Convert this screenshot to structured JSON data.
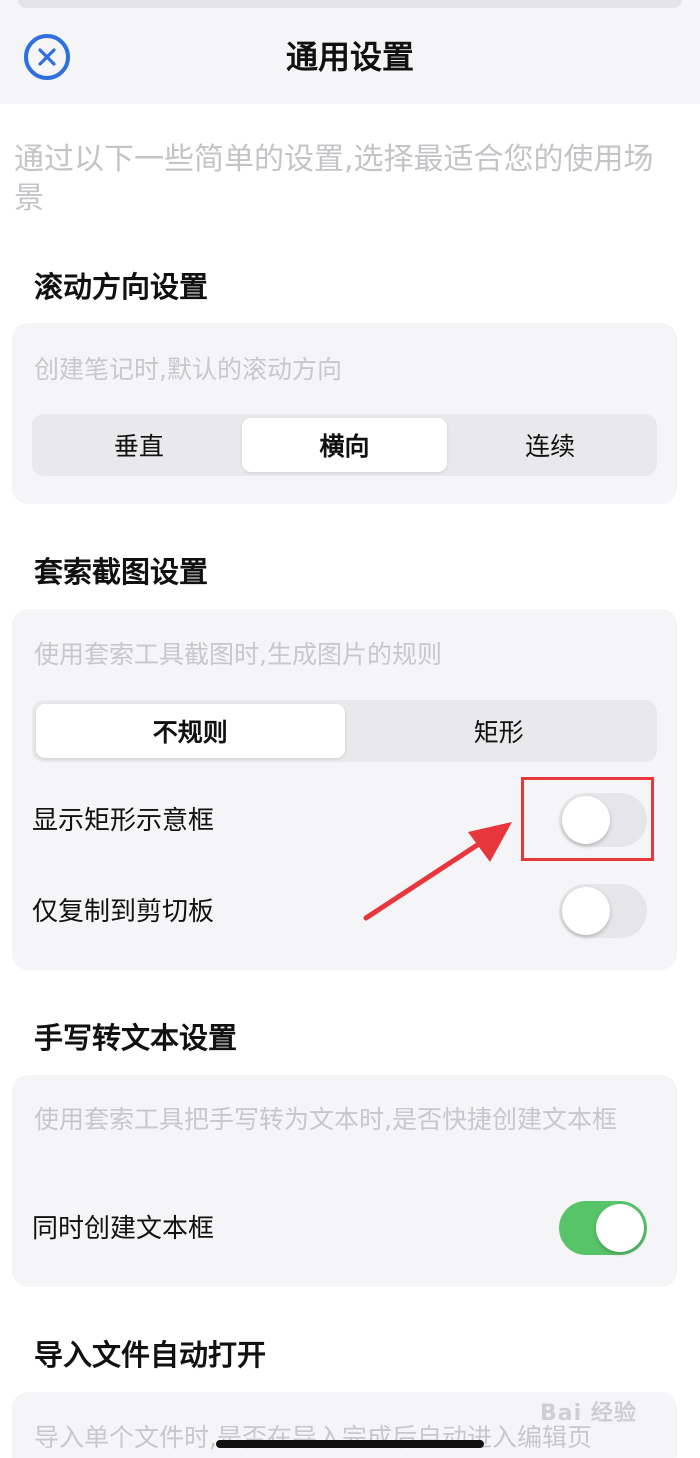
{
  "header": {
    "title": "通用设置",
    "close_icon": "close-circle-icon",
    "accent_color": "#2f6fe0"
  },
  "intro": "通过以下一些简单的设置,选择最适合您的使用场景",
  "sections": {
    "scroll": {
      "title": "滚动方向设置",
      "description": "创建笔记时,默认的滚动方向",
      "options": [
        "垂直",
        "横向",
        "连续"
      ],
      "selected": "横向"
    },
    "lasso": {
      "title": "套索截图设置",
      "description": "使用套索工具截图时,生成图片的规则",
      "options": [
        "不规则",
        "矩形"
      ],
      "selected": "不规则",
      "toggles": [
        {
          "label": "显示矩形示意框",
          "on": false
        },
        {
          "label": "仅复制到剪切板",
          "on": false
        }
      ]
    },
    "handwriting": {
      "title": "手写转文本设置",
      "description": "使用套索工具把手写转为文本时,是否快捷创建文本框",
      "toggles": [
        {
          "label": "同时创建文本框",
          "on": true
        }
      ]
    },
    "import": {
      "title": "导入文件自动打开",
      "description": "导入单个文件时,是否在导入完成后自动进入编辑页"
    }
  },
  "annotation": {
    "highlight_color": "#e8363d"
  },
  "watermark": {
    "text": "Bai 经验"
  },
  "toggle_on_color": "#58c46a"
}
